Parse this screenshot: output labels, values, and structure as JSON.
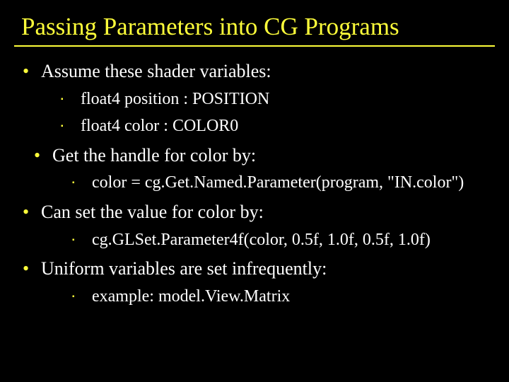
{
  "title": "Passing Parameters into CG Programs",
  "items": {
    "b1": "Assume these shader variables:",
    "b1_s1": "float4 position : POSITION",
    "b1_s2": "float4 color : COLOR0",
    "b2": "Get the handle for color by:",
    "b2_s1": "color = cg.Get.Named.Parameter(program, \"IN.color\")",
    "b3": "Can set the value for color by:",
    "b3_s1": "cg.GLSet.Parameter4f(color, 0.5f, 1.0f, 0.5f, 1.0f)",
    "b4": "Uniform variables are set infrequently:",
    "b4_s1": "example: model.View.Matrix"
  }
}
